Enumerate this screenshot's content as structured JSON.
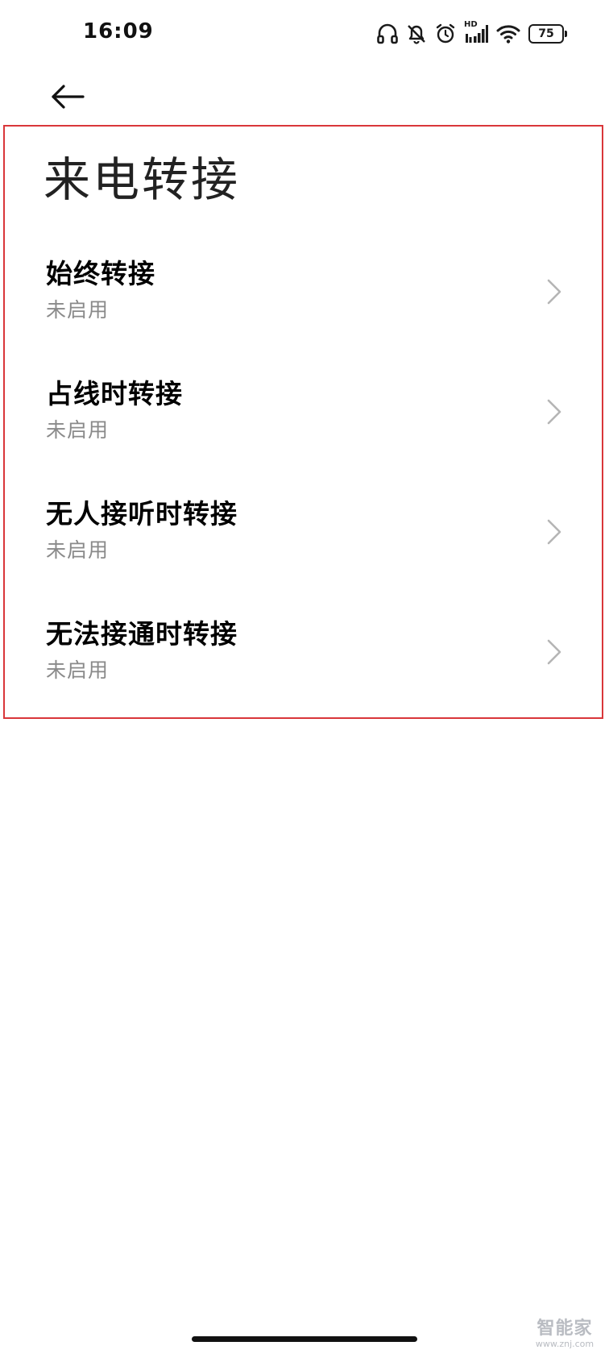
{
  "status_bar": {
    "time": "16:09",
    "signal_label": "HD",
    "battery_level": "75",
    "icons": [
      "headphones-icon",
      "bell-muted-icon",
      "alarm-icon",
      "signal-icon",
      "wifi-icon",
      "battery-icon"
    ]
  },
  "header": {
    "back_icon": "arrow-left-icon",
    "title": "来电转接"
  },
  "items": [
    {
      "title": "始终转接",
      "subtitle": "未启用"
    },
    {
      "title": "占线时转接",
      "subtitle": "未启用"
    },
    {
      "title": "无人接听时转接",
      "subtitle": "未启用"
    },
    {
      "title": "无法接通时转接",
      "subtitle": "未启用"
    }
  ],
  "watermark": {
    "main": "智能家",
    "sub": "www.znj.com"
  },
  "colors": {
    "highlight_frame": "#d9363a",
    "subtitle_text": "#8a8a8a",
    "chevron": "#b5b5b5",
    "watermark": "#b9bcc2"
  }
}
